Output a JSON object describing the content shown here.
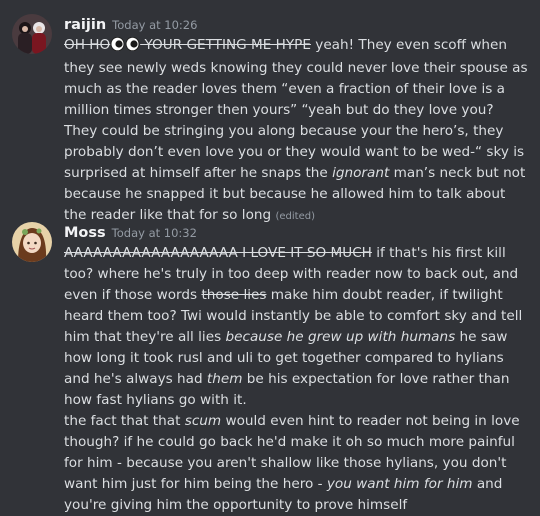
{
  "messages": [
    {
      "username": "raijin",
      "timestamp": "Today at 10:26",
      "avatar_icon": "user-avatar-raijin",
      "strike_before": "OH HO",
      "emoji": "eyes",
      "strike_after": " YOUR GETTING ME HYPE",
      "text_1": " yeah! They even scoff when they see newly weds knowing they could never love their spouse as much as the reader loves them “even a fraction of their love is a million times stronger then yours” “yeah but do they love you? They could be stringing you along because your the hero’s, they probably don’t even love you or they would want to be wed-“ sky is surprised at himself after he snaps the ",
      "italic_1": "ignorant",
      "text_2": " man’s neck but not because he snapped it but because he allowed him to talk about the reader like that for so long",
      "edited": "(edited)"
    },
    {
      "username": "Moss",
      "timestamp": "Today at 10:32",
      "avatar_icon": "user-avatar-moss",
      "strike_1": "AAAAAAAAAAAAAAAAAA I LOVE IT SO MUCH",
      "text_1": " if that's his first kill too? where he's truly in too deep with reader now to back out, and even if those words ",
      "strike_2": "those lies",
      "text_2": " make him doubt reader, if twilight heard them too? Twi would instantly be able to comfort sky and tell him that they're all lies ",
      "italic_1": "because he grew up with humans",
      "text_3": " he saw how long it took rusl and uli to get together compared to hylians and he's always had ",
      "italic_2": "them",
      "text_4": " be his expectation for love rather than how fast hylians go with it.",
      "line_2_a": "the fact that that ",
      "italic_3": "scum",
      "line_2_b": " would even hint to reader not being in love though? if he could go back he'd make it oh so much more painful for him - because you aren't shallow like those hylians, you don't want him just for him being the hero - ",
      "italic_4": "you want him for him",
      "line_2_c": " and you're giving him the opportunity to prove himself"
    }
  ]
}
